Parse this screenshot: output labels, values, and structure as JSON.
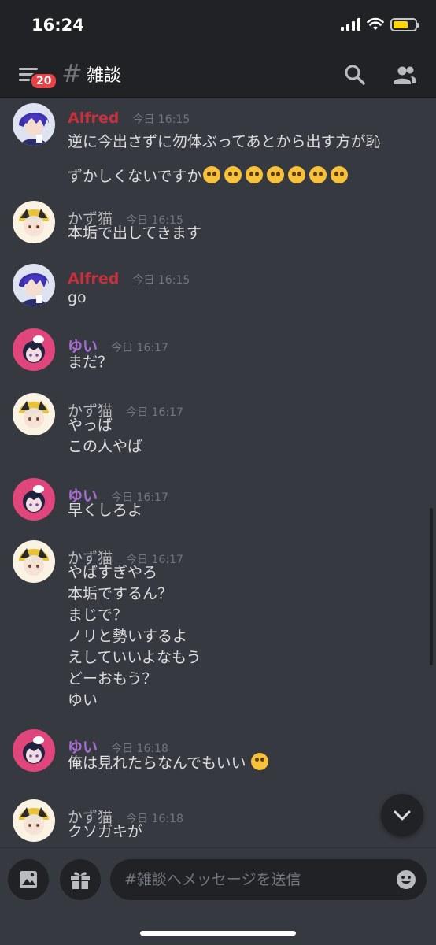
{
  "status_bar": {
    "time": "16:24"
  },
  "header": {
    "badge_count": "20",
    "hash": "#",
    "channel_name": "雑談"
  },
  "messages": [
    {
      "author": "Alfred",
      "author_color": "#c7303c",
      "timestamp": "今日 16:15",
      "lines": [
        "逆に今出さずに勿体ぶってあとから出す方が恥",
        "ずかしくないですか"
      ],
      "emoji_count": 7
    },
    {
      "author": "かず猫",
      "author_color": "#b9bbbe",
      "timestamp": "今日 16:15",
      "lines": [
        "本垢で出してきます"
      ]
    },
    {
      "author": "Alfred",
      "author_color": "#c7303c",
      "timestamp": "今日 16:15",
      "lines": [
        "go"
      ]
    },
    {
      "author": "ゆい",
      "author_color": "#a96cd1",
      "timestamp": "今日 16:17",
      "lines": [
        "まだ？"
      ]
    },
    {
      "author": "かず猫",
      "author_color": "#b9bbbe",
      "timestamp": "今日 16:17",
      "lines": [
        "やっば",
        "この人やば"
      ]
    },
    {
      "author": "ゆい",
      "author_color": "#a96cd1",
      "timestamp": "今日 16:17",
      "lines": [
        "早くしろよ"
      ]
    },
    {
      "author": "かず猫",
      "author_color": "#b9bbbe",
      "timestamp": "今日 16:17",
      "lines": [
        "やばすぎやろ",
        "本垢でするん？",
        "まじで？",
        "ノリと勢いするよ",
        "えしていいよなもう",
        "どーおもう？",
        "ゆい"
      ]
    },
    {
      "author": "ゆい",
      "author_color": "#a96cd1",
      "timestamp": "今日 16:18",
      "lines": [
        "俺は見れたらなんでもいい"
      ]
    },
    {
      "author": "かず猫",
      "author_color": "#b9bbbe",
      "timestamp": "今日 16:18",
      "lines": [
        "クソガキが"
      ]
    }
  ],
  "composer": {
    "placeholder": "#雑談へメッセージを送信"
  },
  "colors": {
    "background": "#36393f",
    "header": "#202225",
    "badge": "#ed4245"
  }
}
